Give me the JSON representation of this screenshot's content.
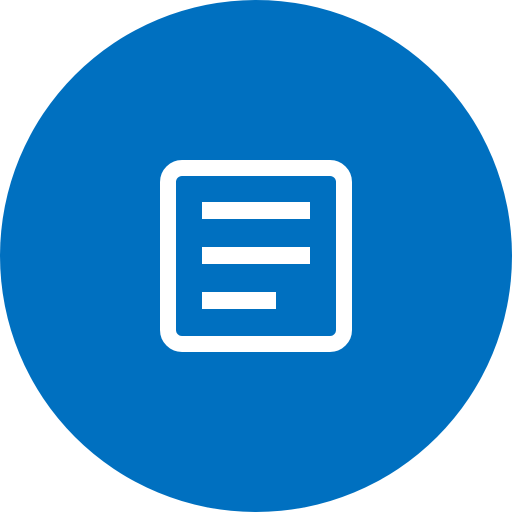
{
  "icon": {
    "name": "document-icon",
    "background_color": "#0070C0",
    "foreground_color": "#FFFFFF"
  }
}
